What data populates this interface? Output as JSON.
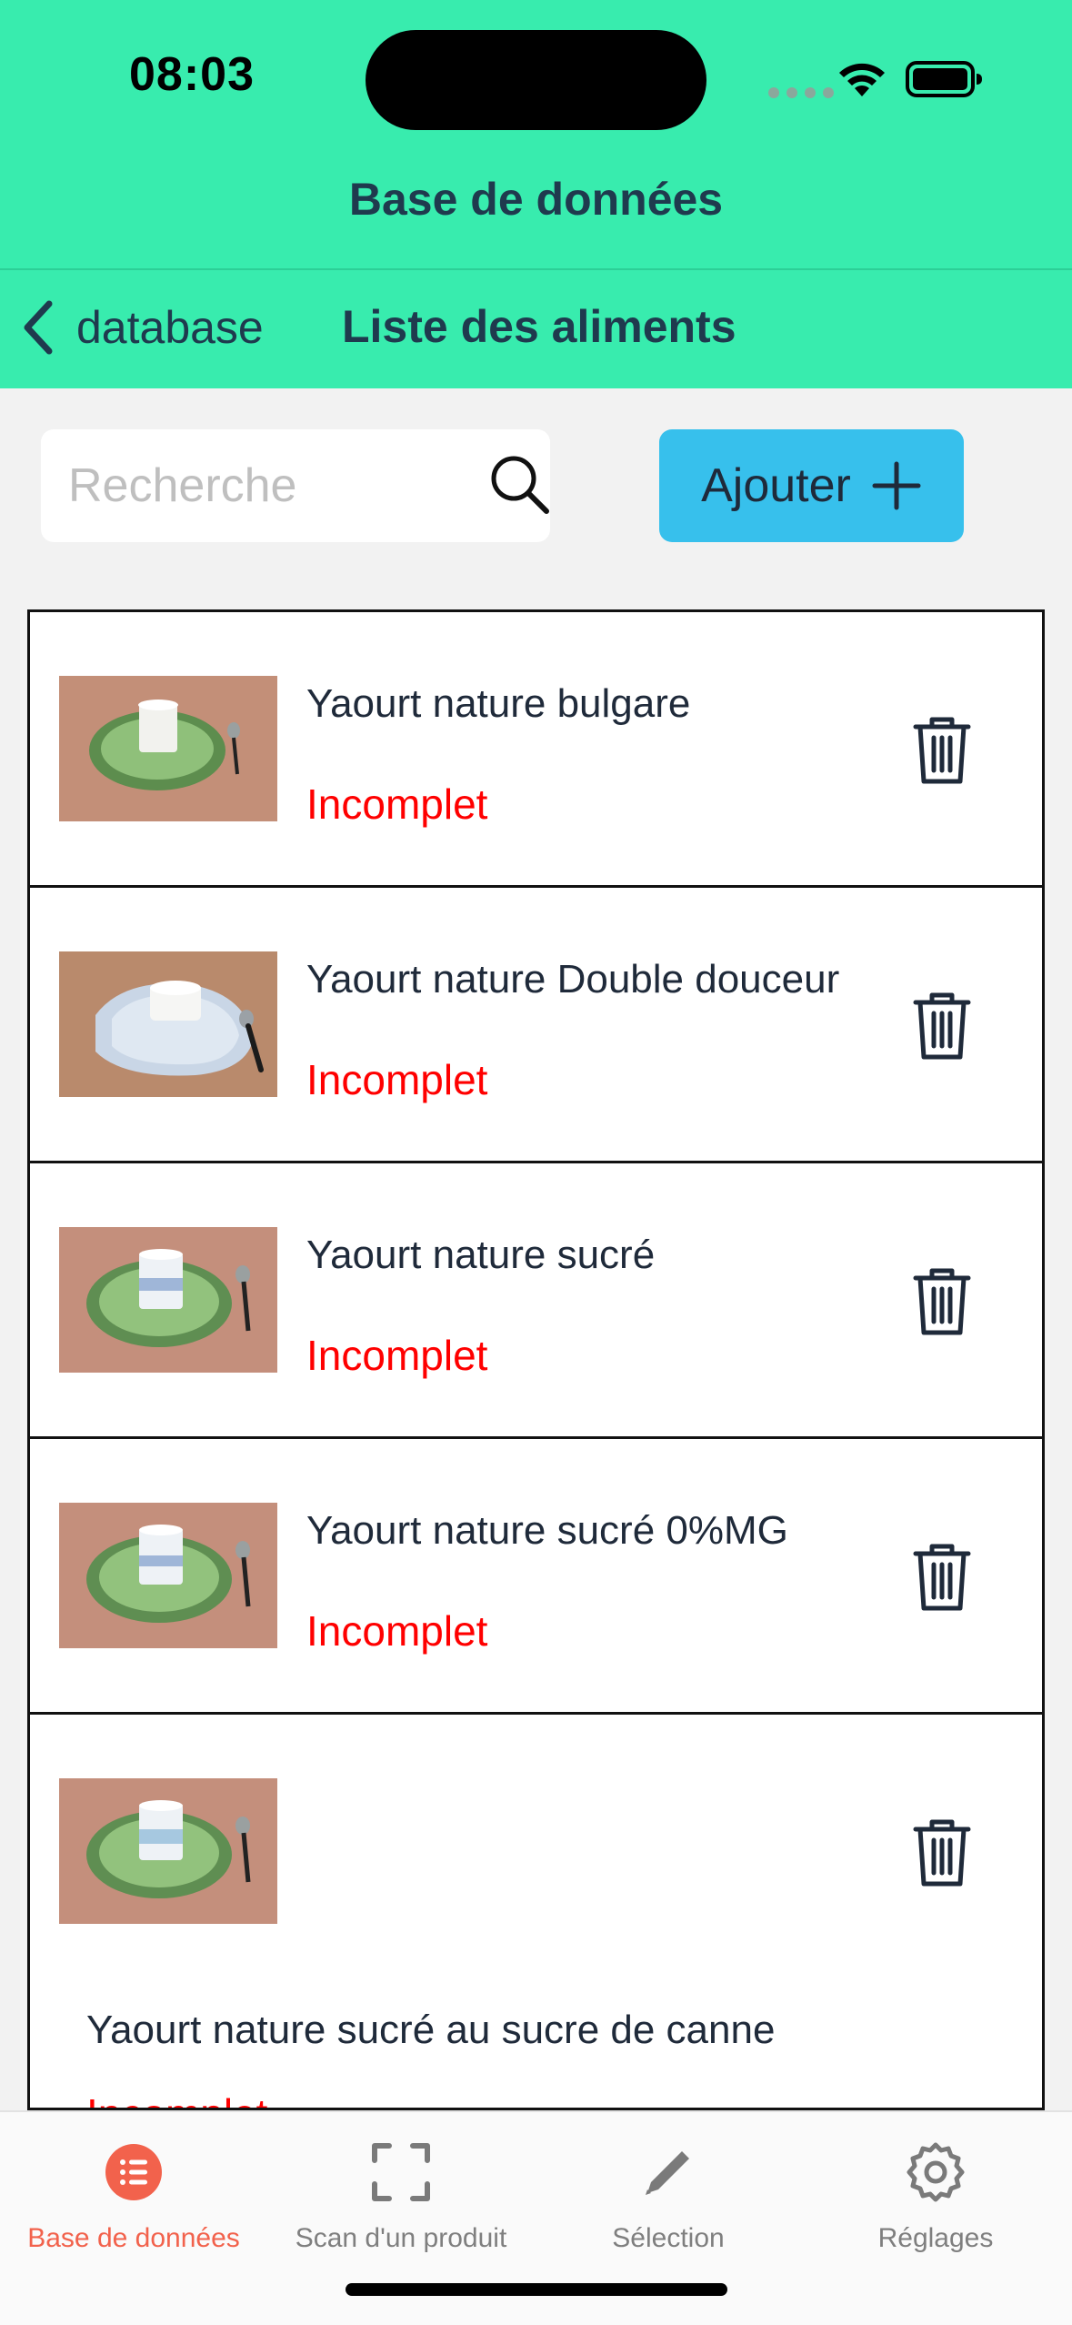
{
  "status_bar": {
    "time": "08:03"
  },
  "header": {
    "app_title": "Base de données",
    "back_label": "database",
    "page_title": "Liste des aliments"
  },
  "search": {
    "placeholder": "Recherche",
    "value": ""
  },
  "add_button": {
    "label": "Ajouter"
  },
  "items": [
    {
      "name": "Yaourt nature bulgare",
      "status": "Incomplet"
    },
    {
      "name": "Yaourt nature Double douceur",
      "status": "Incomplet"
    },
    {
      "name": "Yaourt nature sucré",
      "status": "Incomplet"
    },
    {
      "name": "Yaourt nature sucré 0%MG",
      "status": "Incomplet"
    },
    {
      "name": "Yaourt nature sucré au sucre de canne",
      "status": "Incomplet"
    }
  ],
  "tabbar": {
    "tabs": [
      {
        "label": "Base de données",
        "icon": "list-icon",
        "active": true
      },
      {
        "label": "Scan d'un produit",
        "icon": "scan-icon",
        "active": false
      },
      {
        "label": "Sélection",
        "icon": "pencil-icon",
        "active": false
      },
      {
        "label": "Réglages",
        "icon": "gear-icon",
        "active": false
      }
    ]
  },
  "colors": {
    "header_bg": "#38ecae",
    "add_button_bg": "#37c0ec",
    "status_incomplete": "#ff0000",
    "tab_active": "#f2624c"
  }
}
